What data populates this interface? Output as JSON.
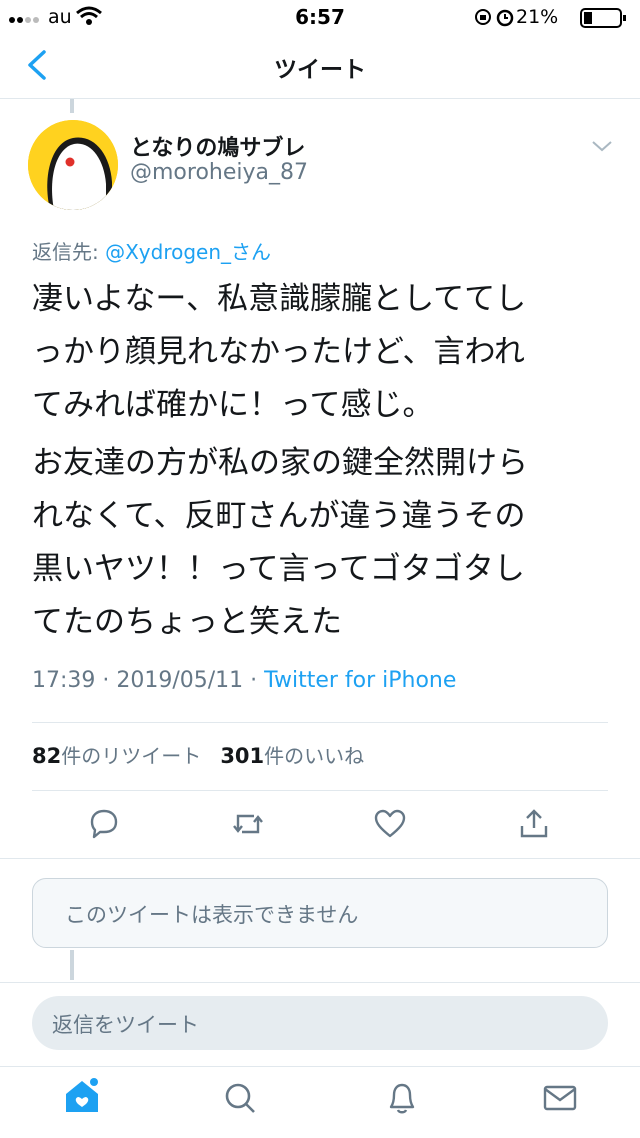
{
  "status_bar": {
    "carrier": "au",
    "time": "6:57",
    "battery": "21%"
  },
  "nav": {
    "title": "ツイート"
  },
  "tweet": {
    "display_name": "となりの鳩サブレ",
    "handle": "@moroheiya_87",
    "reply_prefix": "返信先: ",
    "reply_to": "@Xydrogen_さん",
    "body_lines_1": [
      "凄いよなー、私意識朦朧としててし",
      "っかり顔見れなかったけど、言われ",
      "てみれば確かに！って感じ。"
    ],
    "body_lines_2": [
      "お友達の方が私の家の鍵全然開けら",
      "れなくて、反町さんが違う違うその",
      "黒いヤツ！！って言ってゴタゴタし",
      "てたのちょっと笑えた"
    ],
    "timestamp": "17:39 · 2019/05/11 · ",
    "source": "Twitter for iPhone",
    "retweet_count": "82",
    "retweet_label": "件のリツイート",
    "like_count": "301",
    "like_label": "件のいいね"
  },
  "unavailable_tweet": "このツイートは表示できません",
  "reply_placeholder": "返信をツイート",
  "colors": {
    "accent": "#1da1f2",
    "muted": "#657786",
    "border": "#e1e8ed"
  },
  "icons": [
    "back-chevron-icon",
    "reply-icon",
    "retweet-icon",
    "like-icon",
    "share-icon",
    "home-icon",
    "search-icon",
    "notifications-icon",
    "messages-icon"
  ]
}
